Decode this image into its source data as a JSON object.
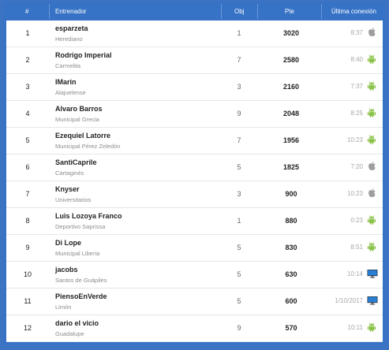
{
  "header": {
    "rank": "#",
    "coach": "Entrenador",
    "obj": "Obj",
    "pts": "Pte",
    "last": "Última conexión"
  },
  "colors": {
    "header_bg": "#3672c6",
    "page_bg": "#3c73c2",
    "android": "#8bc34a",
    "apple": "#9e9e9e",
    "desktop": "#2a7fd4"
  },
  "rows": [
    {
      "rank": "1",
      "name": "esparzeta",
      "team": "Herediano",
      "obj": "1",
      "pts": "3020",
      "last": "8:37",
      "os": "apple-icon"
    },
    {
      "rank": "2",
      "name": "Rodrigo Imperial",
      "team": "Carmelita",
      "obj": "7",
      "pts": "2580",
      "last": "8:40",
      "os": "android-icon"
    },
    {
      "rank": "3",
      "name": "IMarin",
      "team": "Alajuelense",
      "obj": "3",
      "pts": "2160",
      "last": "7:37",
      "os": "android-icon"
    },
    {
      "rank": "4",
      "name": "Alvaro Barros",
      "team": "Municipal Grecia",
      "obj": "9",
      "pts": "2048",
      "last": "8:25",
      "os": "android-icon"
    },
    {
      "rank": "5",
      "name": "Ezequiel Latorre",
      "team": "Municipal Pérez Zeledón",
      "obj": "7",
      "pts": "1956",
      "last": "10:23",
      "os": "android-icon"
    },
    {
      "rank": "6",
      "name": "SantiCaprile",
      "team": "Cartaginés",
      "obj": "5",
      "pts": "1825",
      "last": "7:20",
      "os": "apple-icon"
    },
    {
      "rank": "7",
      "name": "Knyser",
      "team": "Universitarios",
      "obj": "3",
      "pts": "900",
      "last": "10:23",
      "os": "apple-icon"
    },
    {
      "rank": "8",
      "name": "Luis Lozoya Franco",
      "team": "Deportivo Saprissa",
      "obj": "1",
      "pts": "880",
      "last": "0:23",
      "os": "android-icon"
    },
    {
      "rank": "9",
      "name": "Di Lope",
      "team": "Municipal Liberia",
      "obj": "5",
      "pts": "830",
      "last": "8:51",
      "os": "android-icon"
    },
    {
      "rank": "10",
      "name": "jacobs",
      "team": "Santos de Guápiles",
      "obj": "5",
      "pts": "630",
      "last": "10:14",
      "os": "desktop-icon"
    },
    {
      "rank": "11",
      "name": "PiensoEnVerde",
      "team": "Limón",
      "obj": "5",
      "pts": "600",
      "last": "1/10/2017",
      "os": "desktop-icon"
    },
    {
      "rank": "12",
      "name": "dario el vicio",
      "team": "Guadalupe",
      "obj": "9",
      "pts": "570",
      "last": "10:11",
      "os": "android-icon"
    }
  ]
}
